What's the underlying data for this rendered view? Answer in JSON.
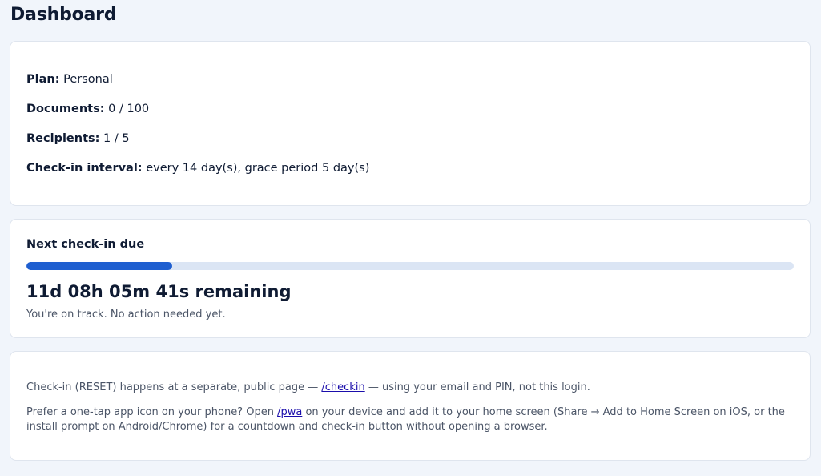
{
  "header": {
    "title": "Dashboard"
  },
  "plan_card": {
    "plan_label": "Plan:",
    "plan_value": "Personal",
    "documents_label": "Documents:",
    "documents_value": "0 / 100",
    "recipients_label": "Recipients:",
    "recipients_value": "1 / 5",
    "interval_label": "Check-in interval:",
    "interval_value": "every 14 day(s), grace period 5 day(s)"
  },
  "checkin_card": {
    "heading": "Next check-in due",
    "progress_fraction": 0.19,
    "progress_color": "#1f5fd0",
    "countdown": "11d 08h 05m 41s remaining",
    "status": "You're on track. No action needed yet."
  },
  "info_card": {
    "p1_before": "Check-in (RESET) happens at a separate, public page — ",
    "p1_link": "/checkin",
    "p1_after": " — using your email and PIN, not this login.",
    "p2_before": "Prefer a one-tap app icon on your phone? Open ",
    "p2_link": "/pwa",
    "p2_after": " on your device and add it to your home screen (Share → Add to Home Screen on iOS, or the install prompt on Android/Chrome) for a countdown and check-in button without opening a browser."
  }
}
